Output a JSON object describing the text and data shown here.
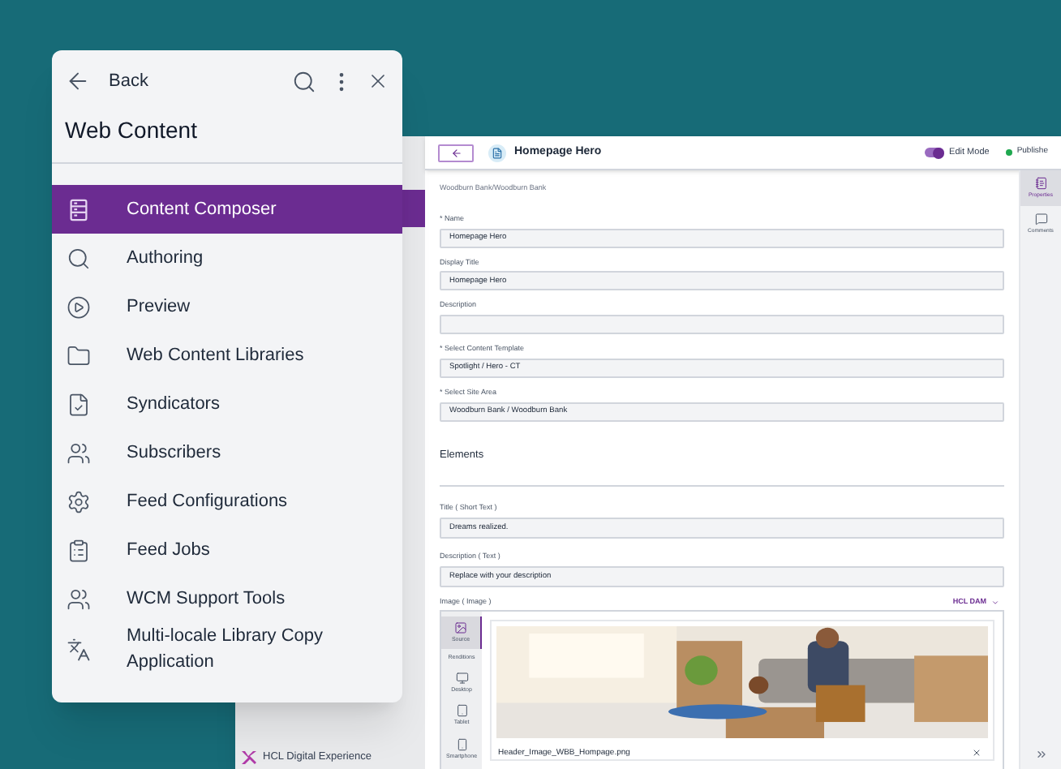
{
  "panel": {
    "back_label": "Back",
    "title": "Web Content",
    "items": [
      {
        "label": "Content Composer",
        "selected": true
      },
      {
        "label": "Authoring",
        "selected": false
      },
      {
        "label": "Preview",
        "selected": false
      },
      {
        "label": "Web Content Libraries",
        "selected": false
      },
      {
        "label": "Syndicators",
        "selected": false
      },
      {
        "label": "Subscribers",
        "selected": false
      },
      {
        "label": "Feed Configurations",
        "selected": false
      },
      {
        "label": "Feed Jobs",
        "selected": false
      },
      {
        "label": "WCM Support Tools",
        "selected": false
      },
      {
        "label": "Multi-locale Library Copy Application",
        "selected": false
      }
    ]
  },
  "app": {
    "brand": "HCL Digital Experience",
    "topbar": {
      "title": "Homepage Hero",
      "edit_mode": {
        "label": "Edit Mode",
        "on": true
      },
      "status": "Publishe"
    },
    "breadcrumb": "Woodburn Bank/Woodburn Bank",
    "fields": [
      {
        "label": "* Name",
        "value": "Homepage Hero"
      },
      {
        "label": "Display Title",
        "value": "Homepage Hero"
      },
      {
        "label": "Description"
      },
      {
        "label": "* Select Content Template",
        "value": "Spotlight / Hero - CT"
      },
      {
        "label": "* Select Site Area",
        "value": "Woodburn Bank / Woodburn Bank"
      }
    ],
    "elements_heading": "Elements",
    "elements": [
      {
        "label": "Title ( Short Text )",
        "value": "Dreams realized."
      },
      {
        "label": "Description ( Text )",
        "value": "Replace with your description"
      }
    ],
    "image": {
      "label": "Image ( Image )",
      "source": "HCL DAM",
      "tabs": [
        {
          "label": "Source",
          "selected": true
        },
        {
          "label": "Renditions",
          "selected": false
        },
        {
          "label": "Desktop",
          "selected": false
        },
        {
          "label": "Tablet",
          "selected": false
        },
        {
          "label": "Smartphone",
          "selected": false
        }
      ],
      "filename": "Header_Image_WBB_Hompage.png"
    },
    "rail": [
      {
        "label": "Properties",
        "selected": true
      },
      {
        "label": "Comments",
        "selected": false
      }
    ]
  }
}
